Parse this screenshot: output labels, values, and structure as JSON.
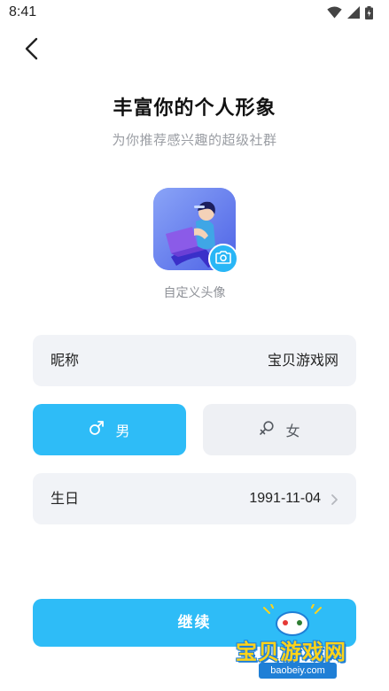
{
  "status_bar": {
    "time": "8:41",
    "icons": [
      "wifi-icon",
      "signal-icon",
      "battery-icon"
    ]
  },
  "nav": {
    "back_icon": "chevron-left-icon"
  },
  "header": {
    "title": "丰富你的个人形象",
    "subtitle": "为你推荐感兴趣的超级社群"
  },
  "avatar": {
    "caption": "自定义头像",
    "camera_icon": "camera-icon"
  },
  "form": {
    "nickname": {
      "label": "昵称",
      "value": "宝贝游戏网"
    },
    "gender": {
      "selected": "male",
      "options": [
        {
          "key": "male",
          "label": "男",
          "icon": "male-icon"
        },
        {
          "key": "female",
          "label": "女",
          "icon": "female-icon"
        }
      ]
    },
    "birthday": {
      "label": "生日",
      "value": "1991-11-04"
    }
  },
  "actions": {
    "continue_label": "继续"
  },
  "watermark": {
    "name": "宝贝游戏网",
    "url": "baobeiy.com"
  },
  "colors": {
    "accent": "#2ebcf7",
    "field_bg": "#f1f3f7",
    "subtitle": "#9a9da3",
    "watermark_yellow": "#ffd31a",
    "watermark_blue": "#1f7fd6"
  }
}
